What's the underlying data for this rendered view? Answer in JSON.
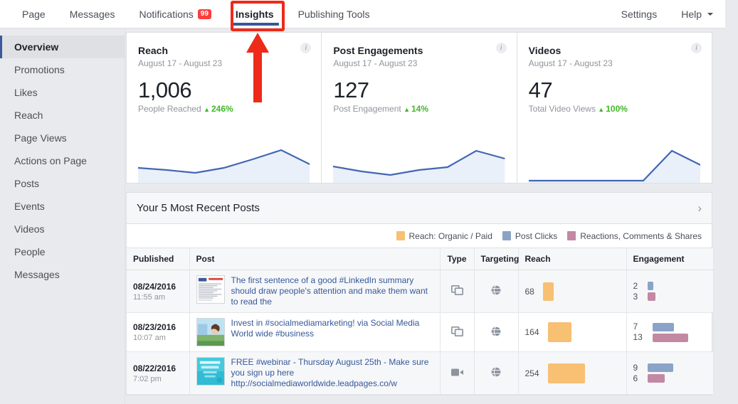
{
  "topnav": {
    "left_items": [
      {
        "label": "Page",
        "name": "nav-page",
        "badge": null,
        "caret": false,
        "active": false
      },
      {
        "label": "Messages",
        "name": "nav-messages",
        "badge": null,
        "caret": false,
        "active": false
      },
      {
        "label": "Notifications",
        "name": "nav-notifications",
        "badge": "99",
        "caret": false,
        "active": false
      },
      {
        "label": "Insights",
        "name": "nav-insights",
        "badge": null,
        "caret": false,
        "active": true
      },
      {
        "label": "Publishing Tools",
        "name": "nav-publishing-tools",
        "badge": null,
        "caret": false,
        "active": false
      }
    ],
    "right_items": [
      {
        "label": "Settings",
        "name": "nav-settings",
        "badge": null,
        "caret": false,
        "active": false
      },
      {
        "label": "Help",
        "name": "nav-help",
        "badge": null,
        "caret": true,
        "active": false
      }
    ]
  },
  "sidebar": {
    "items": [
      {
        "label": "Overview",
        "active": true
      },
      {
        "label": "Promotions",
        "active": false
      },
      {
        "label": "Likes",
        "active": false
      },
      {
        "label": "Reach",
        "active": false
      },
      {
        "label": "Page Views",
        "active": false
      },
      {
        "label": "Actions on Page",
        "active": false
      },
      {
        "label": "Posts",
        "active": false
      },
      {
        "label": "Events",
        "active": false
      },
      {
        "label": "Videos",
        "active": false
      },
      {
        "label": "People",
        "active": false
      },
      {
        "label": "Messages",
        "active": false
      }
    ]
  },
  "cards": [
    {
      "title": "Reach",
      "range": "August 17 - August 23",
      "value": "1,006",
      "sub_label": "People Reached",
      "change": "246%",
      "change_direction": "up",
      "info_icon": "i"
    },
    {
      "title": "Post Engagements",
      "range": "August 17 - August 23",
      "value": "127",
      "sub_label": "Post Engagement",
      "change": "14%",
      "change_direction": "up",
      "info_icon": "i"
    },
    {
      "title": "Videos",
      "range": "August 17 - August 23",
      "value": "47",
      "sub_label": "Total Video Views",
      "change": "100%",
      "change_direction": "up",
      "info_icon": "i"
    }
  ],
  "chart_data": [
    {
      "type": "area",
      "title": "Reach",
      "x": [
        0,
        1,
        2,
        3,
        4,
        5,
        6
      ],
      "values": [
        36,
        30,
        22,
        36,
        60,
        86,
        46
      ],
      "ylim": [
        0,
        100
      ],
      "xlabel": "",
      "ylabel": "People Reached",
      "grid": false,
      "legend": "none",
      "line_color": "#4267b2",
      "fill_color": "#eaf0fa"
    },
    {
      "type": "area",
      "title": "Post Engagements",
      "x": [
        0,
        1,
        2,
        3,
        4,
        5,
        6
      ],
      "values": [
        40,
        26,
        16,
        30,
        38,
        84,
        62
      ],
      "ylim": [
        0,
        100
      ],
      "xlabel": "",
      "ylabel": "Post Engagement",
      "grid": false,
      "legend": "none",
      "line_color": "#4267b2",
      "fill_color": "#eaf0fa"
    },
    {
      "type": "area",
      "title": "Videos",
      "x": [
        0,
        1,
        2,
        3,
        4,
        5,
        6
      ],
      "values": [
        0,
        0,
        0,
        0,
        0,
        84,
        44
      ],
      "ylim": [
        0,
        100
      ],
      "xlabel": "",
      "ylabel": "Total Video Views",
      "grid": false,
      "legend": "none",
      "line_color": "#4267b2",
      "fill_color": "#eaf0fa"
    }
  ],
  "posts_panel": {
    "title": "Your 5 Most Recent Posts",
    "chevron": "›",
    "legend": [
      {
        "label": "Reach: Organic / Paid",
        "color": "#f7c073"
      },
      {
        "label": "Post Clicks",
        "color": "#8ba3c7"
      },
      {
        "label": "Reactions, Comments & Shares",
        "color": "#c389a3"
      }
    ],
    "columns": [
      "Published",
      "Post",
      "Type",
      "Targeting",
      "Reach",
      "Engagement"
    ],
    "rows": [
      {
        "date": "08/24/2016",
        "time": "11:55 am",
        "text": "The first sentence of a good #LinkedIn summary should draw people's attention and make them want to read the",
        "thumb": "document-screenshot",
        "type_icon": "shared-post-icon",
        "targeting_icon": "globe-icon",
        "reach": "68",
        "reach_bar_width": 15,
        "reach_bar_height": 26,
        "clicks": "2",
        "reactions": "3",
        "clicks_bar_width": 8,
        "reactions_bar_width": 11
      },
      {
        "date": "08/23/2016",
        "time": "10:07 am",
        "text": "Invest in #socialmediamarketing! via Social Media World wide #business",
        "thumb": "woman-photo",
        "type_icon": "shared-post-icon",
        "targeting_icon": "globe-icon",
        "reach": "164",
        "reach_bar_width": 33,
        "reach_bar_height": 28,
        "clicks": "7",
        "reactions": "13",
        "clicks_bar_width": 30,
        "reactions_bar_width": 50
      },
      {
        "date": "08/22/2016",
        "time": "7:02 pm",
        "text": "FREE #webinar - Thursday August 25th - Make sure you sign up here http://socialmediaworldwide.leadpages.co/w",
        "thumb": "webinar-graphic",
        "type_icon": "video-icon",
        "targeting_icon": "globe-icon",
        "reach": "254",
        "reach_bar_width": 52,
        "reach_bar_height": 28,
        "clicks": "9",
        "reactions": "6",
        "clicks_bar_width": 36,
        "reactions_bar_width": 24
      }
    ]
  },
  "annotation": {
    "shape": "red-box-and-arrow",
    "target": "Insights",
    "color": "#ee2a19"
  }
}
